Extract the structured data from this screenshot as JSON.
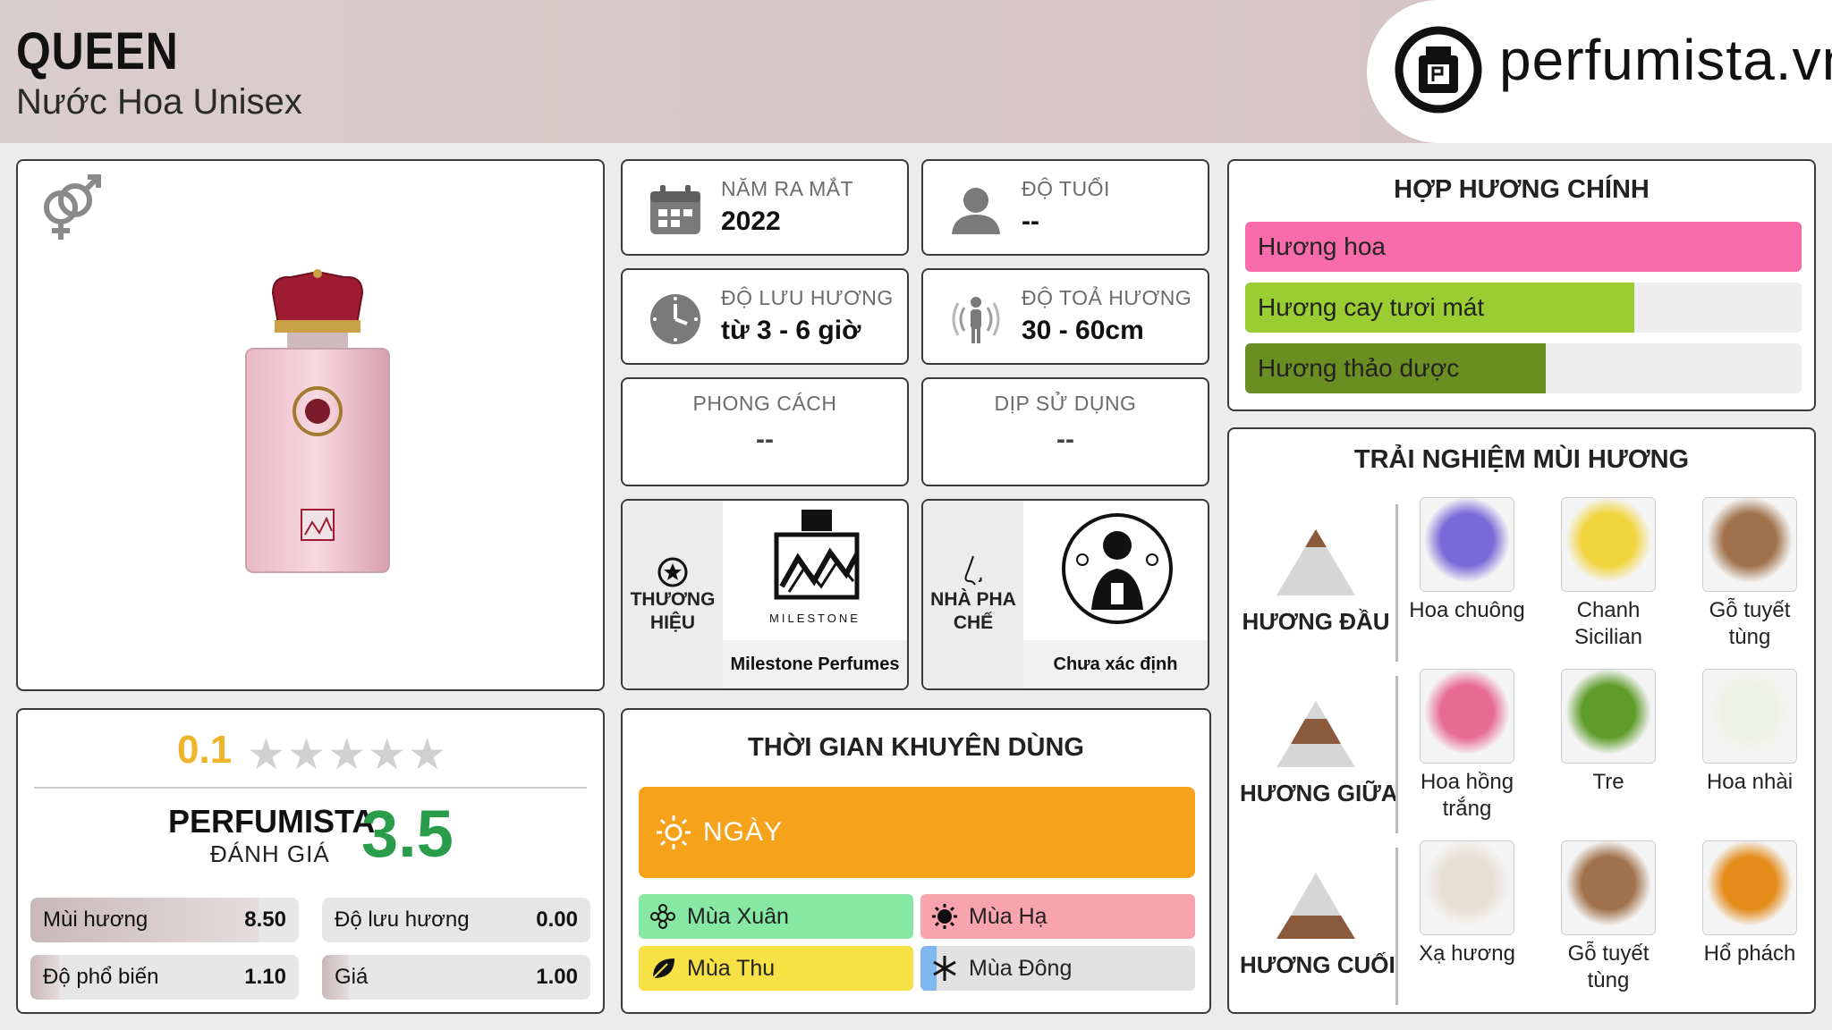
{
  "header": {
    "title": "QUEEN",
    "subtitle": "Nước Hoa Unisex",
    "brand_site": "perfumista.vn"
  },
  "info": {
    "launch": {
      "label": "NĂM RA MẮT",
      "value": "2022"
    },
    "age": {
      "label": "ĐỘ TUỔI",
      "value": "--"
    },
    "longevity": {
      "label": "ĐỘ LƯU HƯƠNG",
      "value": "từ 3 - 6 giờ"
    },
    "sillage": {
      "label": "ĐỘ TOẢ HƯƠNG",
      "value": "30 - 60cm"
    },
    "style": {
      "label": "PHONG CÁCH",
      "value": "--"
    },
    "occasion": {
      "label": "DỊP SỬ DỤNG",
      "value": "--"
    },
    "brand": {
      "label": "THƯƠNG HIỆU",
      "name": "Milestone Perfumes",
      "logo_text": "MILESTONE"
    },
    "perfumer": {
      "label": "NHÀ PHA CHẾ",
      "name": "Chưa xác định"
    }
  },
  "accords": {
    "title": "HỢP HƯƠNG CHÍNH",
    "items": [
      {
        "label": "Hương hoa",
        "percent": 100,
        "color": "#f76bab"
      },
      {
        "label": "Hương cay tươi mát",
        "percent": 70,
        "color": "#9acd32"
      },
      {
        "label": "Hương thảo dược",
        "percent": 54,
        "color": "#6b8e23"
      }
    ]
  },
  "experience": {
    "title": "TRẢI NGHIỆM MÙI HƯƠNG",
    "tiers": [
      {
        "label": "HƯƠNG ĐẦU",
        "notes": [
          "Hoa chuông",
          "Chanh Sicilian",
          "Gỗ tuyết tùng"
        ]
      },
      {
        "label": "HƯƠNG GIỮA",
        "notes": [
          "Hoa hồng trắng",
          "Tre",
          "Hoa nhài"
        ]
      },
      {
        "label": "HƯƠNG CUỐI",
        "notes": [
          "Xạ hương",
          "Gỗ tuyết tùng",
          "Hổ phách"
        ]
      }
    ]
  },
  "rating": {
    "user_score": "0.1",
    "stars_total": 5,
    "perfumista_label": "PERFUMISTA",
    "perfumista_sub": "ĐÁNH GIÁ",
    "perfumista_score": "3.5",
    "metrics": [
      {
        "name": "Mùi hương",
        "value": "8.50",
        "fraction": 0.85
      },
      {
        "name": "Độ lưu hương",
        "value": "0.00",
        "fraction": 0.0
      },
      {
        "name": "Độ phổ biến",
        "value": "1.10",
        "fraction": 0.11
      },
      {
        "name": "Giá",
        "value": "1.00",
        "fraction": 0.1
      }
    ]
  },
  "time": {
    "title": "THỜI GIAN KHUYÊN DÙNG",
    "day_label": "NGÀY",
    "seasons": [
      {
        "label": "Mùa Xuân",
        "fraction": 1.0,
        "color": "#86e8a2",
        "icon": "flower-icon"
      },
      {
        "label": "Mùa Hạ",
        "fraction": 1.0,
        "color": "#f8a3ad",
        "icon": "sun-icon"
      },
      {
        "label": "Mùa Thu",
        "fraction": 1.0,
        "color": "#f7e246",
        "icon": "leaf-icon"
      },
      {
        "label": "Mùa Đông",
        "fraction": 0.06,
        "color": "#7fb8f0",
        "icon": "snowflake-icon"
      }
    ]
  }
}
